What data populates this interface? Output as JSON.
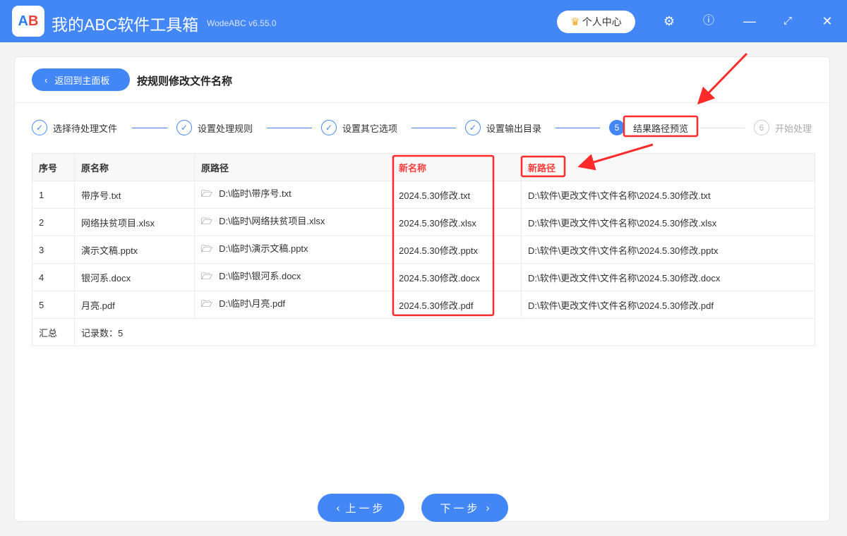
{
  "app": {
    "title": "我的ABC软件工具箱",
    "version": "WodeABC v6.55.0",
    "logo_text": "AB",
    "user_center": "个人中心"
  },
  "header": {
    "back_label": "返回到主面板",
    "page_title": "按规则修改文件名称"
  },
  "steps": [
    {
      "label": "选择待处理文件",
      "state": "done"
    },
    {
      "label": "设置处理规则",
      "state": "done"
    },
    {
      "label": "设置其它选项",
      "state": "done"
    },
    {
      "label": "设置输出目录",
      "state": "done"
    },
    {
      "number": "5",
      "label": "结果路径预览",
      "state": "active"
    },
    {
      "number": "6",
      "label": "开始处理",
      "state": "todo"
    }
  ],
  "table": {
    "headers": [
      "序号",
      "原名称",
      "原路径",
      "新名称",
      "新路径"
    ],
    "rows": [
      [
        "1",
        "带序号.txt",
        "D:\\临时\\带序号.txt",
        "2024.5.30修改.txt",
        "D:\\软件\\更改文件\\文件名称\\2024.5.30修改.txt"
      ],
      [
        "2",
        "网络扶贫项目.xlsx",
        "D:\\临时\\网络扶贫项目.xlsx",
        "2024.5.30修改.xlsx",
        "D:\\软件\\更改文件\\文件名称\\2024.5.30修改.xlsx"
      ],
      [
        "3",
        "演示文稿.pptx",
        "D:\\临时\\演示文稿.pptx",
        "2024.5.30修改.pptx",
        "D:\\软件\\更改文件\\文件名称\\2024.5.30修改.pptx"
      ],
      [
        "4",
        "银河系.docx",
        "D:\\临时\\银河系.docx",
        "2024.5.30修改.docx",
        "D:\\软件\\更改文件\\文件名称\\2024.5.30修改.docx"
      ],
      [
        "5",
        "月亮.pdf",
        "D:\\临时\\月亮.pdf",
        "2024.5.30修改.pdf",
        "D:\\软件\\更改文件\\文件名称\\2024.5.30修改.pdf"
      ]
    ],
    "summary_label": "汇总",
    "summary_value": "记录数：5"
  },
  "footer": {
    "prev_label": "上一步",
    "next_label": "下一步"
  },
  "colors": {
    "accent": "#4387f6",
    "highlight": "#ff2b2b"
  }
}
